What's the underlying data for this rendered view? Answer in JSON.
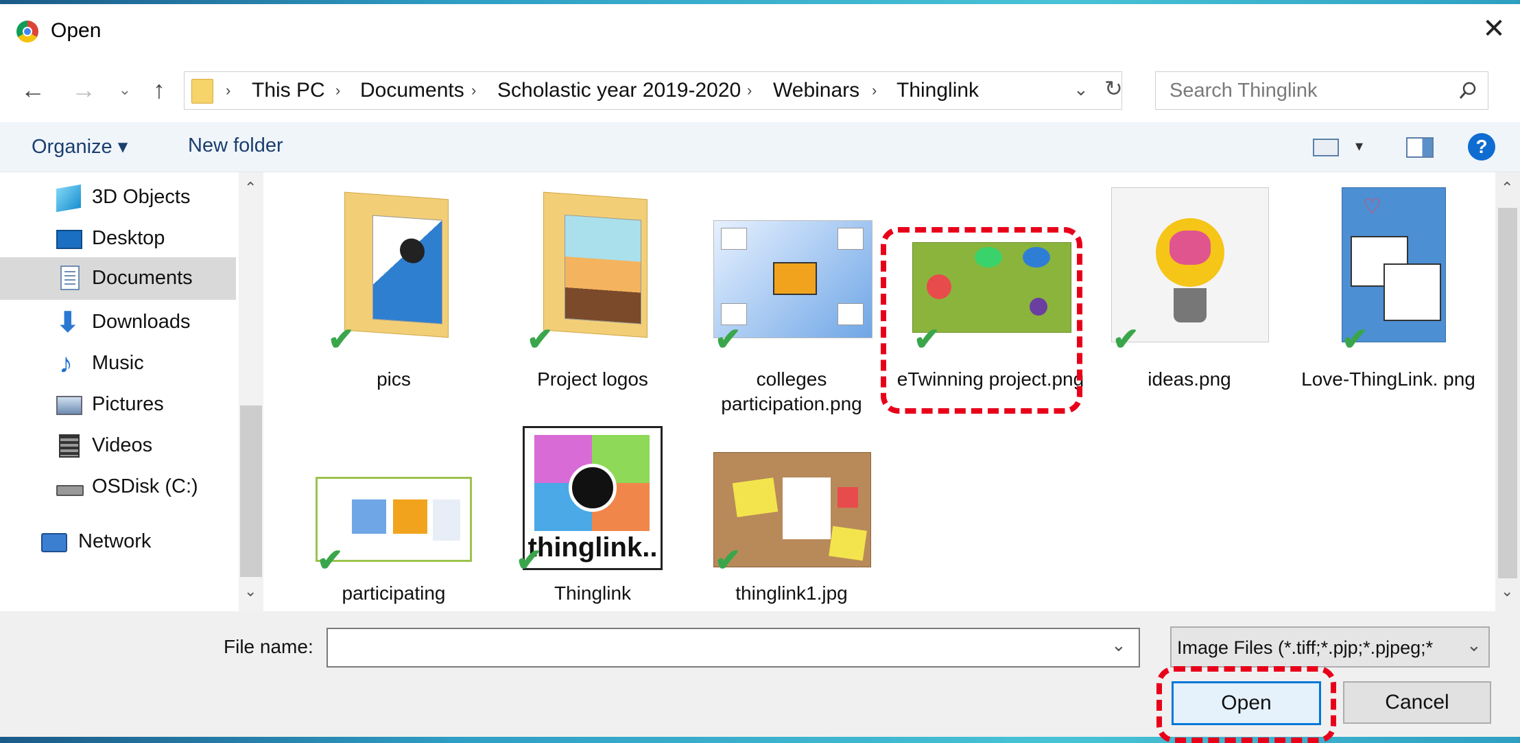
{
  "window": {
    "title": "Open"
  },
  "address": {
    "crumbs": [
      "This PC",
      "Documents",
      "Scholastic year 2019-2020",
      "Webinars",
      "Thinglink"
    ]
  },
  "search": {
    "placeholder": "Search Thinglink"
  },
  "toolbar": {
    "organize": "Organize ▾",
    "new_folder": "New folder",
    "help": "?"
  },
  "sidebar": {
    "items": [
      {
        "label": "3D Objects",
        "icon": "3d-objects-icon"
      },
      {
        "label": "Desktop",
        "icon": "desktop-icon"
      },
      {
        "label": "Documents",
        "icon": "documents-icon",
        "selected": true
      },
      {
        "label": "Downloads",
        "icon": "downloads-icon"
      },
      {
        "label": "Music",
        "icon": "music-icon"
      },
      {
        "label": "Pictures",
        "icon": "pictures-icon"
      },
      {
        "label": "Videos",
        "icon": "videos-icon"
      },
      {
        "label": "OSDisk (C:)",
        "icon": "drive-icon"
      },
      {
        "label": "Network",
        "icon": "network-icon"
      }
    ]
  },
  "files": [
    {
      "name": "pics",
      "type": "folder"
    },
    {
      "name": "Project logos",
      "type": "folder"
    },
    {
      "name": "colleges participation.png",
      "type": "image"
    },
    {
      "name": "eTwinning project.png",
      "type": "image",
      "highlighted": true
    },
    {
      "name": "ideas.png",
      "type": "image"
    },
    {
      "name": "Love-ThingLink. png",
      "type": "image"
    },
    {
      "name": "participating",
      "type": "image"
    },
    {
      "name": "Thinglink",
      "type": "image"
    },
    {
      "name": "thinglink1.jpg",
      "type": "image"
    }
  ],
  "thinglink_logo_text": "thinglink..",
  "footer": {
    "file_name_label": "File name:",
    "file_name_value": "",
    "file_type": "Image Files (*.tiff;*.pjp;*.pjpeg;*",
    "open": "Open",
    "cancel": "Cancel"
  },
  "colors": {
    "highlight": "#e8001a",
    "accent": "#0078d7",
    "check": "#3aa64c"
  }
}
